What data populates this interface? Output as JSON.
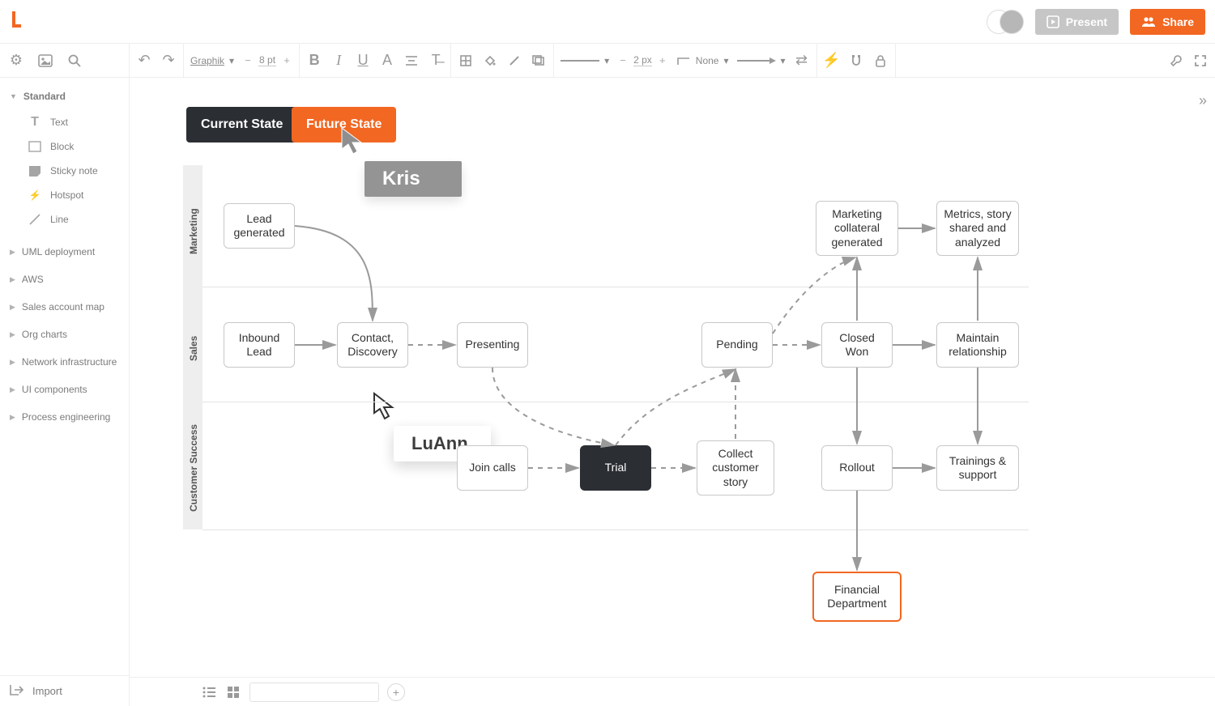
{
  "brand": {
    "present_label": "Present",
    "share_label": "Share"
  },
  "toolbar": {
    "font_family": "Graphik",
    "font_size": "8 pt",
    "line_width": "2 px",
    "line_style": "None"
  },
  "sidebar": {
    "standard_label": "Standard",
    "items": [
      {
        "label": "Text"
      },
      {
        "label": "Block"
      },
      {
        "label": "Sticky note"
      },
      {
        "label": "Hotspot"
      },
      {
        "label": "Line"
      }
    ],
    "sections": [
      {
        "label": "UML deployment"
      },
      {
        "label": "AWS"
      },
      {
        "label": "Sales account map"
      },
      {
        "label": "Org charts"
      },
      {
        "label": "Network infrastructure"
      },
      {
        "label": "UI components"
      },
      {
        "label": "Process engineering"
      }
    ],
    "import_label": "Import"
  },
  "tabs": {
    "current": "Current State",
    "future": "Future State"
  },
  "cursors": {
    "kris": "Kris",
    "luann": "LuAnn"
  },
  "lanes": {
    "marketing": "Marketing",
    "sales": "Sales",
    "cs": "Customer Success"
  },
  "nodes": {
    "lead_generated": "Lead generated",
    "inbound_lead": "Inbound Lead",
    "contact_discovery": "Contact, Discovery",
    "presenting": "Presenting",
    "join_calls": "Join calls",
    "trial": "Trial",
    "collect_story": "Collect customer story",
    "pending": "Pending",
    "closed_won": "Closed Won",
    "rollout": "Rollout",
    "marketing_collateral": "Marketing collateral generated",
    "metrics": "Metrics, story shared and analyzed",
    "maintain": "Maintain relationship",
    "trainings": "Trainings & support",
    "financial": "Financial Department"
  }
}
